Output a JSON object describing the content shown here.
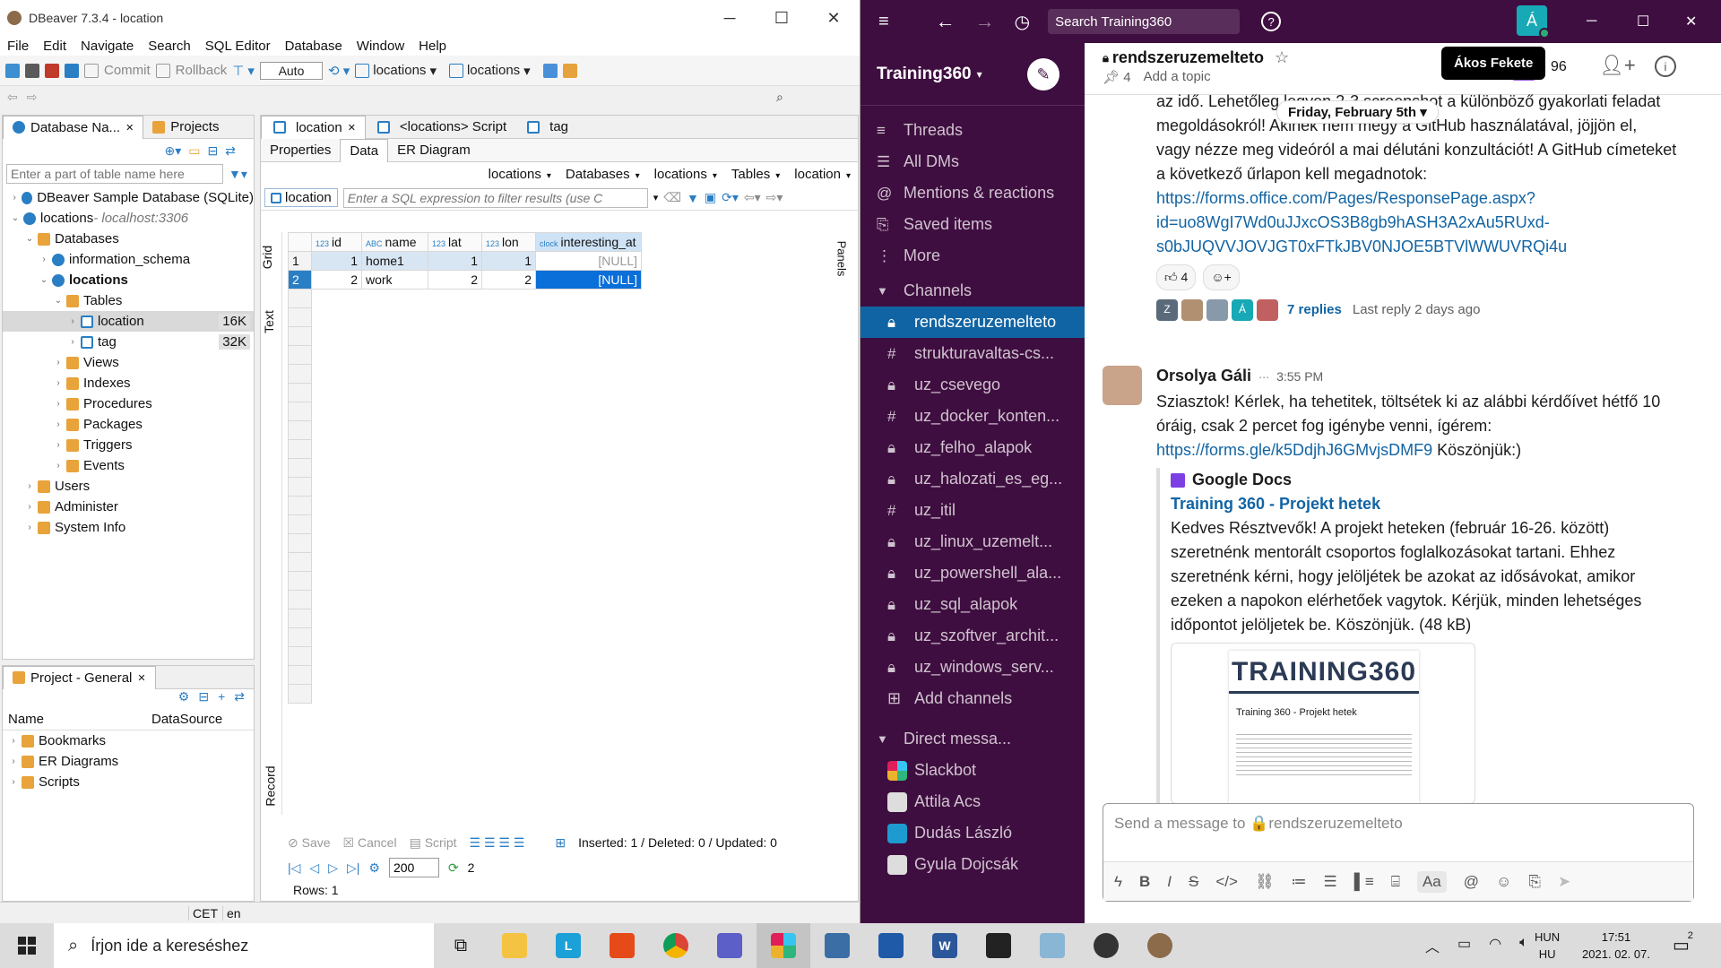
{
  "dbeaver": {
    "title": "DBeaver 7.3.4 - location",
    "menu": [
      "File",
      "Edit",
      "Navigate",
      "Search",
      "SQL Editor",
      "Database",
      "Window",
      "Help"
    ],
    "toolbar": {
      "commit": "Commit",
      "rollback": "Rollback",
      "mode": "Auto",
      "active1": "locations",
      "active2": "locations"
    },
    "navigator": {
      "tab1": "Database Na...",
      "tab2": "Projects",
      "filter_placeholder": "Enter a part of table name here",
      "tree": [
        {
          "label": "DBeaver Sample Database (SQLite)",
          "level": 0,
          "type": "db",
          "open": false
        },
        {
          "label": "locations",
          "extra": " - localhost:3306",
          "level": 0,
          "type": "db",
          "open": true
        },
        {
          "label": "Databases",
          "level": 1,
          "type": "folder",
          "open": true
        },
        {
          "label": "information_schema",
          "level": 2,
          "type": "db",
          "open": false
        },
        {
          "label": "locations",
          "level": 2,
          "type": "db",
          "open": true,
          "bold": true
        },
        {
          "label": "Tables",
          "level": 3,
          "type": "folder",
          "open": true
        },
        {
          "label": "location",
          "level": 4,
          "type": "table",
          "size": "16K",
          "selected": true
        },
        {
          "label": "tag",
          "level": 4,
          "type": "table",
          "size": "32K"
        },
        {
          "label": "Views",
          "level": 3,
          "type": "folder"
        },
        {
          "label": "Indexes",
          "level": 3,
          "type": "folder"
        },
        {
          "label": "Procedures",
          "level": 3,
          "type": "folder"
        },
        {
          "label": "Packages",
          "level": 3,
          "type": "folder"
        },
        {
          "label": "Triggers",
          "level": 3,
          "type": "folder"
        },
        {
          "label": "Events",
          "level": 3,
          "type": "folder"
        },
        {
          "label": "Users",
          "level": 1,
          "type": "folder"
        },
        {
          "label": "Administer",
          "level": 1,
          "type": "folder"
        },
        {
          "label": "System Info",
          "level": 1,
          "type": "folder"
        }
      ]
    },
    "project": {
      "title": "Project - General",
      "col1": "Name",
      "col2": "DataSource",
      "items": [
        "Bookmarks",
        "ER Diagrams",
        "Scripts"
      ]
    },
    "editor": {
      "tabs": [
        "location",
        "<locations> Script",
        "tag"
      ],
      "subtabs": [
        "Properties",
        "Data",
        "ER Diagram"
      ],
      "crumbs": [
        "locations",
        "Databases",
        "locations",
        "Tables",
        "location"
      ],
      "filter_label": "location",
      "filter_placeholder": "Enter a SQL expression to filter results (use C",
      "side_tabs": [
        "Grid",
        "Text",
        "Record"
      ],
      "panels": "Panels",
      "columns": [
        "id",
        "name",
        "lat",
        "lon",
        "interesting_at"
      ],
      "col_types": [
        "123",
        "ABC",
        "123",
        "123",
        "clock"
      ],
      "rows": [
        [
          "1",
          "1",
          "home1",
          "1",
          "1",
          "[NULL]"
        ],
        [
          "2",
          "2",
          "work",
          "2",
          "2",
          "[NULL]"
        ]
      ],
      "bottom": {
        "save": "Save",
        "cancel": "Cancel",
        "script": "Script",
        "status": "Inserted: 1 / Deleted: 0 / Updated: 0",
        "fetch": "200",
        "count": "2",
        "rows": "Rows: 1"
      }
    },
    "status": {
      "tz": "CET",
      "lang": "en"
    }
  },
  "slack": {
    "search": "Search Training360",
    "tooltip": "Ákos Fekete",
    "workspace": "Training360",
    "nav": [
      "Threads",
      "All DMs",
      "Mentions & reactions",
      "Saved items",
      "More"
    ],
    "channels_header": "Channels",
    "channels": [
      {
        "name": "rendszeruzemelteto",
        "lock": true,
        "active": true
      },
      {
        "name": "strukturavaltas-cs...",
        "lock": false
      },
      {
        "name": "uz_csevego",
        "lock": true
      },
      {
        "name": "uz_docker_konten...",
        "lock": false
      },
      {
        "name": "uz_felho_alapok",
        "lock": true
      },
      {
        "name": "uz_halozati_es_eg...",
        "lock": true
      },
      {
        "name": "uz_itil",
        "lock": false
      },
      {
        "name": "uz_linux_uzemelt...",
        "lock": true
      },
      {
        "name": "uz_powershell_ala...",
        "lock": true
      },
      {
        "name": "uz_sql_alapok",
        "lock": true
      },
      {
        "name": "uz_szoftver_archit...",
        "lock": true
      },
      {
        "name": "uz_windows_serv...",
        "lock": true
      }
    ],
    "add_channels": "Add channels",
    "dm_header": "Direct messa...",
    "dms": [
      "Slackbot",
      "Attila Acs",
      "Dudás László",
      "Gyula Dojcsák"
    ],
    "channel": {
      "name": "rendszeruzemelteto",
      "pins": "4",
      "topic": "Add a topic",
      "members": "96"
    },
    "date_divider": "Friday, February 5th",
    "msg1": {
      "lines": [
        "az idő. Lehetőleg legyen 2-3 screenshot a különböző gyakorlati feladat",
        "megoldásokról! Akinek nem megy a GitHub használatával, jöjjön el,",
        "vagy nézze meg videóról a mai délutáni konzultációt! A GitHub címeteket",
        "a következő űrlapon kell megadnotok:"
      ],
      "link": [
        "https://forms.office.com/Pages/ResponsePage.aspx?",
        "id=uo8WgI7Wd0uJJxcOS3B8gb9hASH3A2xAu5RUxd-",
        "s0bJUQVVJOVJGT0xFTkJBV0NJOE5BTVlWWUVRQi4u"
      ],
      "reaction_count": "4",
      "replies": "7 replies",
      "last_reply": "Last reply 2 days ago"
    },
    "msg2": {
      "author": "Orsolya Gáli",
      "time": "3:55 PM",
      "lines": [
        "Sziasztok! Kérlek, ha tehetitek, töltsétek ki az alábbi kérdőívet hétfő 10",
        "óráig, csak 2 percet fog igénybe venni, ígérem:"
      ],
      "link": "https://forms.gle/k5DdjhJ6GMvjsDMF9",
      "after": " Köszönjük:)",
      "att_source": "Google Docs",
      "att_title": "Training 360 - Projekt hetek",
      "att_text": [
        "Kedves Résztvevők! A projekt heteken (február 16-26. között)",
        "szeretnénk mentorált csoportos foglalkozásokat tartani. Ehhez",
        "szeretnénk kérni, hogy jelöljétek be azokat az idősávokat, amikor",
        "ezeken a napokon elérhetőek vagytok. Kérjük, minden lehetséges",
        "időpontot jelöljetek be. Köszönjük. (48 kB)"
      ],
      "preview_logo": "TRAINING360",
      "preview_title": "Training 360 - Projekt hetek"
    },
    "composer": {
      "placeholder": "Send a message to 🔒rendszeruzemelteto"
    }
  },
  "taskbar": {
    "search": "Írjon ide a kereséshez",
    "lang1": "HUN",
    "lang2": "HU",
    "time": "17:51",
    "date": "2021. 02. 07.",
    "notif": "2"
  }
}
